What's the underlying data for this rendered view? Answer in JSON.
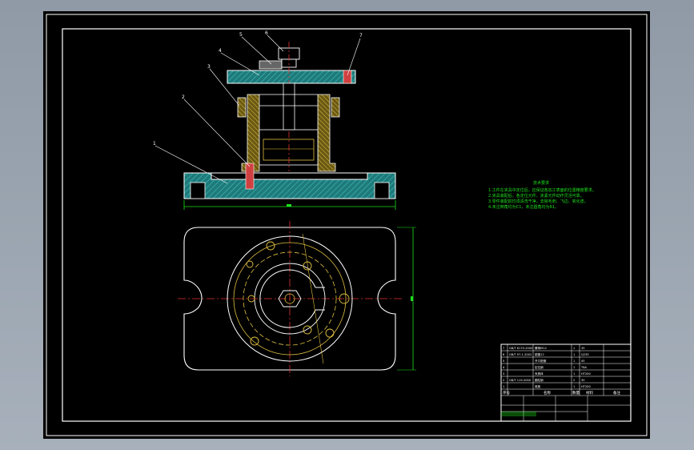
{
  "drawing": {
    "callouts": [
      "1",
      "2",
      "3",
      "4",
      "5",
      "6",
      "7"
    ],
    "technical_requirements": {
      "title": "技术要求",
      "lines": [
        "1.工件在夹具中定位后，应保证各加工表面的位置精度要求。",
        "2.夹具装配后，各定位元件、夹紧元件动作灵活可靠。",
        "3.零件装配前均须清洗干净，去除毛刺、飞边、氧化皮。",
        "4.未注倒角均为C1，未注圆角均为R1。"
      ]
    },
    "title_block": {
      "col_headers": [
        "序号",
        "名称",
        "数量",
        "材料",
        "备注"
      ],
      "parts": [
        [
          "7",
          "GB/T 6170-2000",
          "螺母M12",
          "1",
          "35"
        ],
        [
          "6",
          "GB/T 97.1-2002",
          "垫圈12",
          "1",
          "Q235"
        ],
        [
          "5",
          "",
          "开口垫圈",
          "1",
          "45"
        ],
        [
          "4",
          "",
          "定位销",
          "1",
          "T8A"
        ],
        [
          "3",
          "",
          "夹具体",
          "1",
          "HT200"
        ],
        [
          "2",
          "GB/T 119-2000",
          "圆柱销",
          "2",
          "35"
        ],
        [
          "1",
          "",
          "底座",
          "1",
          "HT200"
        ]
      ]
    }
  }
}
